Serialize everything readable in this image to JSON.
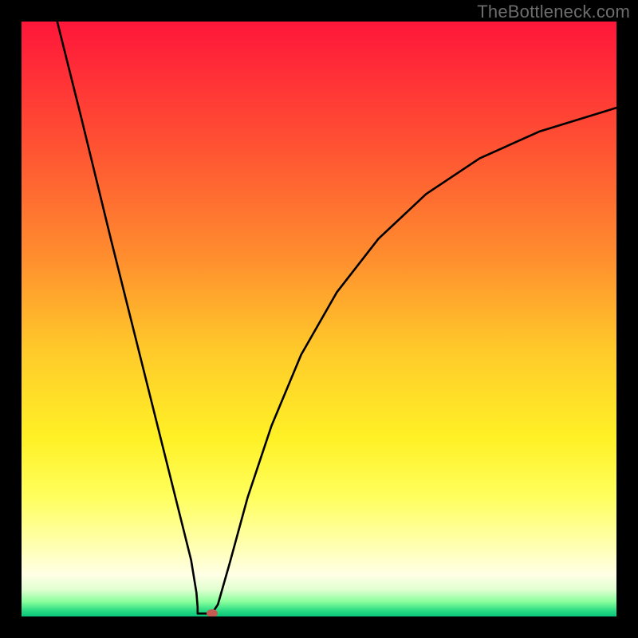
{
  "watermark": "TheBottleneck.com",
  "chart_data": {
    "type": "line",
    "title": "",
    "xlabel": "",
    "ylabel": "",
    "xlim": [
      0,
      100
    ],
    "ylim": [
      0,
      100
    ],
    "gradient_stops": [
      {
        "offset": 0,
        "color": "#ff163a"
      },
      {
        "offset": 0.2,
        "color": "#ff4f33"
      },
      {
        "offset": 0.4,
        "color": "#ff8f2e"
      },
      {
        "offset": 0.55,
        "color": "#ffc92a"
      },
      {
        "offset": 0.7,
        "color": "#fff126"
      },
      {
        "offset": 0.8,
        "color": "#ffff5e"
      },
      {
        "offset": 0.88,
        "color": "#ffffb0"
      },
      {
        "offset": 0.93,
        "color": "#ffffe6"
      },
      {
        "offset": 0.955,
        "color": "#e0ffd0"
      },
      {
        "offset": 0.975,
        "color": "#8aff9c"
      },
      {
        "offset": 0.99,
        "color": "#2bdc84"
      },
      {
        "offset": 1.0,
        "color": "#08c57a"
      }
    ],
    "series": [
      {
        "name": "bottleneck-curve",
        "points": [
          {
            "x": 6.0,
            "y": 100.0
          },
          {
            "x": 10.0,
            "y": 84.0
          },
          {
            "x": 15.0,
            "y": 63.5
          },
          {
            "x": 20.0,
            "y": 43.5
          },
          {
            "x": 24.0,
            "y": 27.5
          },
          {
            "x": 27.0,
            "y": 15.5
          },
          {
            "x": 28.5,
            "y": 9.5
          },
          {
            "x": 29.4,
            "y": 4.0
          },
          {
            "x": 29.6,
            "y": 1.5
          },
          {
            "x": 29.6,
            "y": 0.5
          },
          {
            "x": 31.0,
            "y": 0.5
          },
          {
            "x": 32.0,
            "y": 0.5
          },
          {
            "x": 33.0,
            "y": 2.0
          },
          {
            "x": 35.0,
            "y": 9.0
          },
          {
            "x": 38.0,
            "y": 20.0
          },
          {
            "x": 42.0,
            "y": 32.0
          },
          {
            "x": 47.0,
            "y": 44.0
          },
          {
            "x": 53.0,
            "y": 54.5
          },
          {
            "x": 60.0,
            "y": 63.5
          },
          {
            "x": 68.0,
            "y": 71.0
          },
          {
            "x": 77.0,
            "y": 77.0
          },
          {
            "x": 87.0,
            "y": 81.5
          },
          {
            "x": 100.0,
            "y": 85.5
          }
        ]
      }
    ],
    "marker": {
      "x": 32.0,
      "y": 0.5,
      "color": "#c45a52"
    }
  }
}
